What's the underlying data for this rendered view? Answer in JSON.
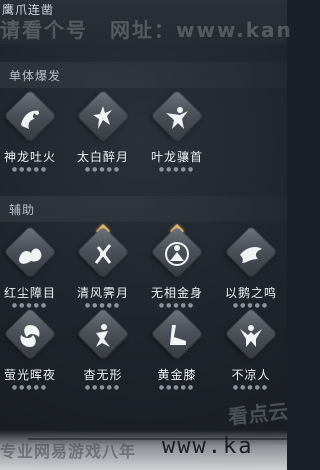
{
  "header": {
    "title": "鹰爪连凿",
    "watermark": "请看个号　网址：www.kan"
  },
  "sections": [
    {
      "label": "单体爆发",
      "skills": [
        {
          "name": "神龙吐火",
          "icon": "dragon-fire-icon"
        },
        {
          "name": "太白醉月",
          "icon": "drunk-moon-icon"
        },
        {
          "name": "叶龙骧首",
          "icon": "dragon-head-icon"
        }
      ]
    },
    {
      "label": "辅助",
      "skills": [
        {
          "name": "红尘障目",
          "icon": "dust-blind-icon"
        },
        {
          "name": "清风霁月",
          "icon": "breeze-moon-icon"
        },
        {
          "name": "无相金身",
          "icon": "golden-body-icon"
        },
        {
          "name": "以鹅之鸣",
          "icon": "goose-cry-icon"
        },
        {
          "name": "萤光晖夜",
          "icon": "firefly-night-icon"
        },
        {
          "name": "杳无形",
          "icon": "formless-icon"
        },
        {
          "name": "黄金膝",
          "icon": "golden-knee-icon"
        },
        {
          "name": "不凉人",
          "icon": "not-cold-icon"
        }
      ]
    }
  ],
  "footer": {
    "watermark_cn": "专业网易游戏八年",
    "watermark_url": "www.ka",
    "stamp": "看点云"
  },
  "colors": {
    "background": "#1f232b",
    "diamond": "#4c5058",
    "pin": "#e2b86a"
  }
}
